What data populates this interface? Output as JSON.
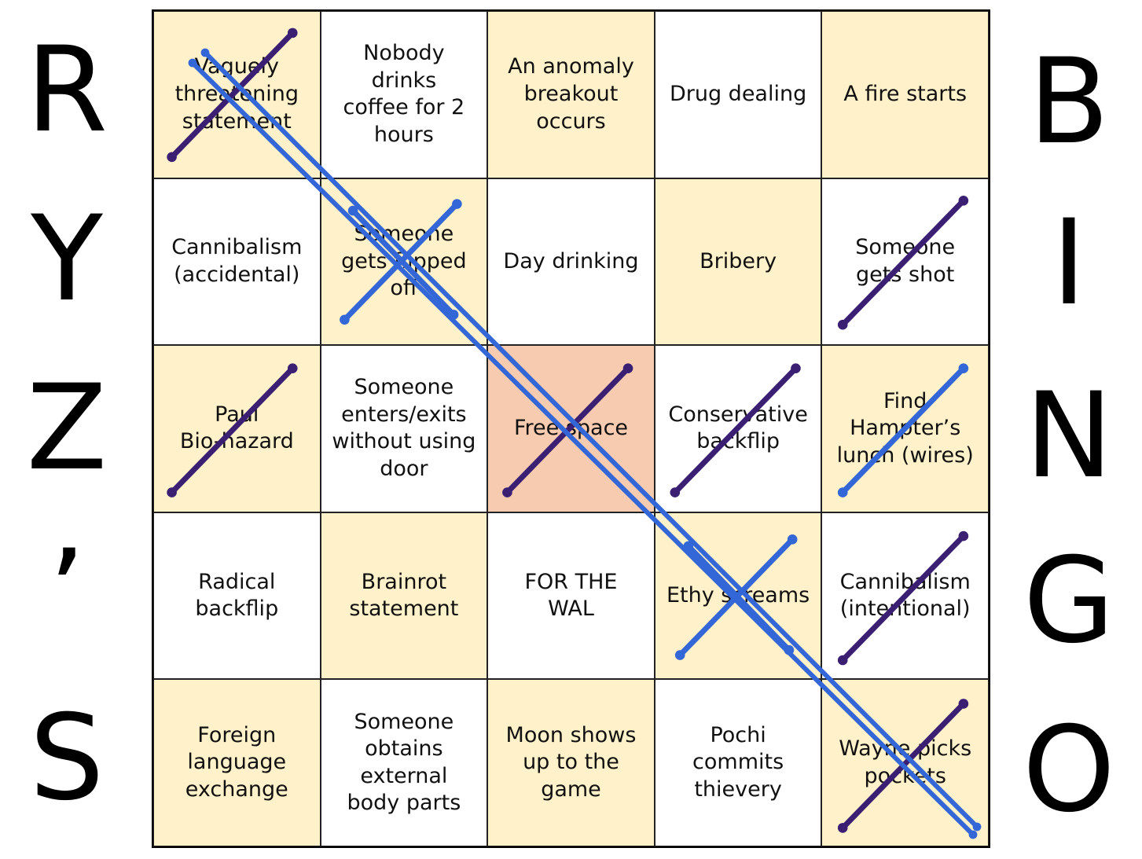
{
  "title_left": [
    "R",
    "Y",
    "Z",
    "’",
    "S"
  ],
  "title_right": [
    "B",
    "I",
    "N",
    "G",
    "O"
  ],
  "colors": {
    "cell_yellow": "#fff1ca",
    "cell_white": "#ffffff",
    "cell_free": "#f7cbb0",
    "mark_purple": "#3a1f73",
    "mark_blue": "#3366d6"
  },
  "cells": [
    {
      "label": "Vaguely\nthreatening\nstatement",
      "bg": "yellow",
      "mark": "slash"
    },
    {
      "label": "Nobody\ndrinks\ncoffee for 2\nhours",
      "bg": "white",
      "mark": "none"
    },
    {
      "label": "An anomaly\nbreakout\noccurs",
      "bg": "yellow",
      "mark": "none"
    },
    {
      "label": "Drug dealing",
      "bg": "white",
      "mark": "none"
    },
    {
      "label": "A fire starts",
      "bg": "yellow",
      "mark": "none"
    },
    {
      "label": "Cannibalism\n(accidental)",
      "bg": "white",
      "mark": "none"
    },
    {
      "label": "Someone\ngets flipped\noff",
      "bg": "yellow",
      "mark": "x"
    },
    {
      "label": "Day drinking",
      "bg": "white",
      "mark": "none"
    },
    {
      "label": "Bribery",
      "bg": "yellow",
      "mark": "none"
    },
    {
      "label": "Someone\ngets shot",
      "bg": "white",
      "mark": "slash"
    },
    {
      "label": "Paul\nBio-hazard",
      "bg": "yellow",
      "mark": "slash"
    },
    {
      "label": "Someone\nenters/exits\nwithout using\ndoor",
      "bg": "white",
      "mark": "none"
    },
    {
      "label": "Free space",
      "bg": "free",
      "mark": "slash"
    },
    {
      "label": "Conservative\nbackflip",
      "bg": "white",
      "mark": "slash"
    },
    {
      "label": "Find\nHampter’s\nlunch (wires)",
      "bg": "yellow",
      "mark": "slash-blue"
    },
    {
      "label": "Radical\nbackflip",
      "bg": "white",
      "mark": "none"
    },
    {
      "label": "Brainrot\nstatement",
      "bg": "yellow",
      "mark": "none"
    },
    {
      "label": "FOR THE\nWAL",
      "bg": "white",
      "mark": "none"
    },
    {
      "label": "Ethy screams",
      "bg": "yellow",
      "mark": "x"
    },
    {
      "label": "Cannibalism\n(intentional)",
      "bg": "white",
      "mark": "slash"
    },
    {
      "label": "Foreign\nlanguage\nexchange",
      "bg": "yellow",
      "mark": "none"
    },
    {
      "label": "Someone\nobtains\nexternal\nbody parts",
      "bg": "white",
      "mark": "none"
    },
    {
      "label": "Moon shows\nup to the\ngame",
      "bg": "yellow",
      "mark": "none"
    },
    {
      "label": "Pochi\ncommits\nthievery",
      "bg": "white",
      "mark": "none"
    },
    {
      "label": "Wayne picks\npockets",
      "bg": "yellow",
      "mark": "slash"
    }
  ],
  "bingo_line": "diagonal-main"
}
